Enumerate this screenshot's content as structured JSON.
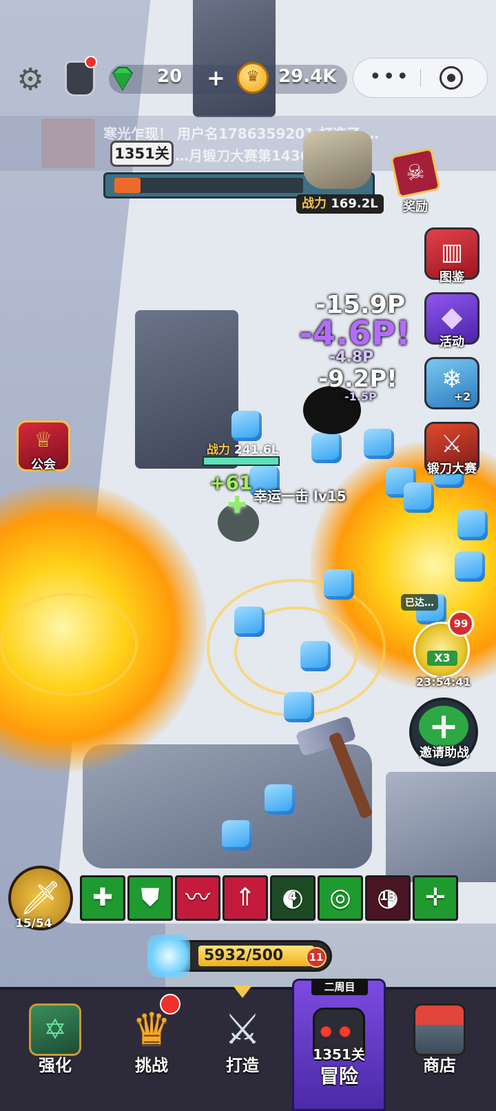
{
  "hud": {
    "gems": "20",
    "gold": "29.4K",
    "gold_icon_glyph": "♛",
    "plus_glyph": "+",
    "capsule_dots": "•••"
  },
  "marquee": {
    "line1": "寒光乍现！ 用户名1786359201 打造了 …",
    "line2": "…月锻刀大赛第14367…"
  },
  "boss": {
    "stage_label": "1351关",
    "progress_fraction": 0.14,
    "power_label": "战力",
    "power_value": "169.2L"
  },
  "side_menu": {
    "reward_label": "奖励",
    "encyclopedia_label": "图鉴",
    "event_label": "活动",
    "pet_badge": "+2",
    "forge_label": "锻刀大赛",
    "guild_label": "公会",
    "gift_claimed_label": "已达…",
    "gift_badge": "99",
    "gift_multiplier": "X3",
    "gift_timer": "23:54:41",
    "invite_label": "邀请助战"
  },
  "damage_numbers": [
    "-15.9P",
    "-4.6P!",
    "-4.8P",
    "-9.2P!",
    "-1.5P"
  ],
  "hero": {
    "power_label": "战力",
    "power_value": "241.6L",
    "hp_fraction": 1.0,
    "heal_text": "+61",
    "skill_text": "幸运一击 lv15"
  },
  "skills": {
    "weapon_count": "15/54",
    "slots": [
      {
        "icon": "heal-cross-icon",
        "glyph": "✚",
        "color": "#1f9a2f",
        "count": ""
      },
      {
        "icon": "shield-icon",
        "glyph": "⛊",
        "color": "#1f9a2f",
        "count": ""
      },
      {
        "icon": "slash-icon",
        "glyph": "〰",
        "color": "#c41b3c",
        "count": ""
      },
      {
        "icon": "rage-arrow-icon",
        "glyph": "⇑",
        "color": "#c41b3c",
        "count": ""
      },
      {
        "icon": "cooldown-icon",
        "glyph": "◐",
        "color": "#1d4a24",
        "count": "4"
      },
      {
        "icon": "target-ring-icon",
        "glyph": "◎",
        "color": "#1f9a2f",
        "count": ""
      },
      {
        "icon": "cooldown-icon",
        "glyph": "◑",
        "color": "#4a1524",
        "count": "13"
      },
      {
        "icon": "plus-cross-icon",
        "glyph": "✛",
        "color": "#1f9a2f",
        "count": ""
      }
    ]
  },
  "energy": {
    "text": "5932/500",
    "badge": "11"
  },
  "nav": {
    "items": [
      {
        "label": "强化",
        "icon": "upgrade-book-icon"
      },
      {
        "label": "挑战",
        "icon": "crown-icon"
      },
      {
        "label": "打造",
        "icon": "sword-icon"
      },
      {
        "label": "冒险",
        "icon": "adventure-helmet-icon"
      },
      {
        "label": "商店",
        "icon": "shop-icon"
      }
    ],
    "active_banner": "二周目",
    "active_stage": "1351关"
  },
  "colors": {
    "accent_orange": "#ef6a2a",
    "heal_green": "#9cf25a",
    "damage_white": "#ffffff",
    "crit_purple": "#b46cff"
  }
}
